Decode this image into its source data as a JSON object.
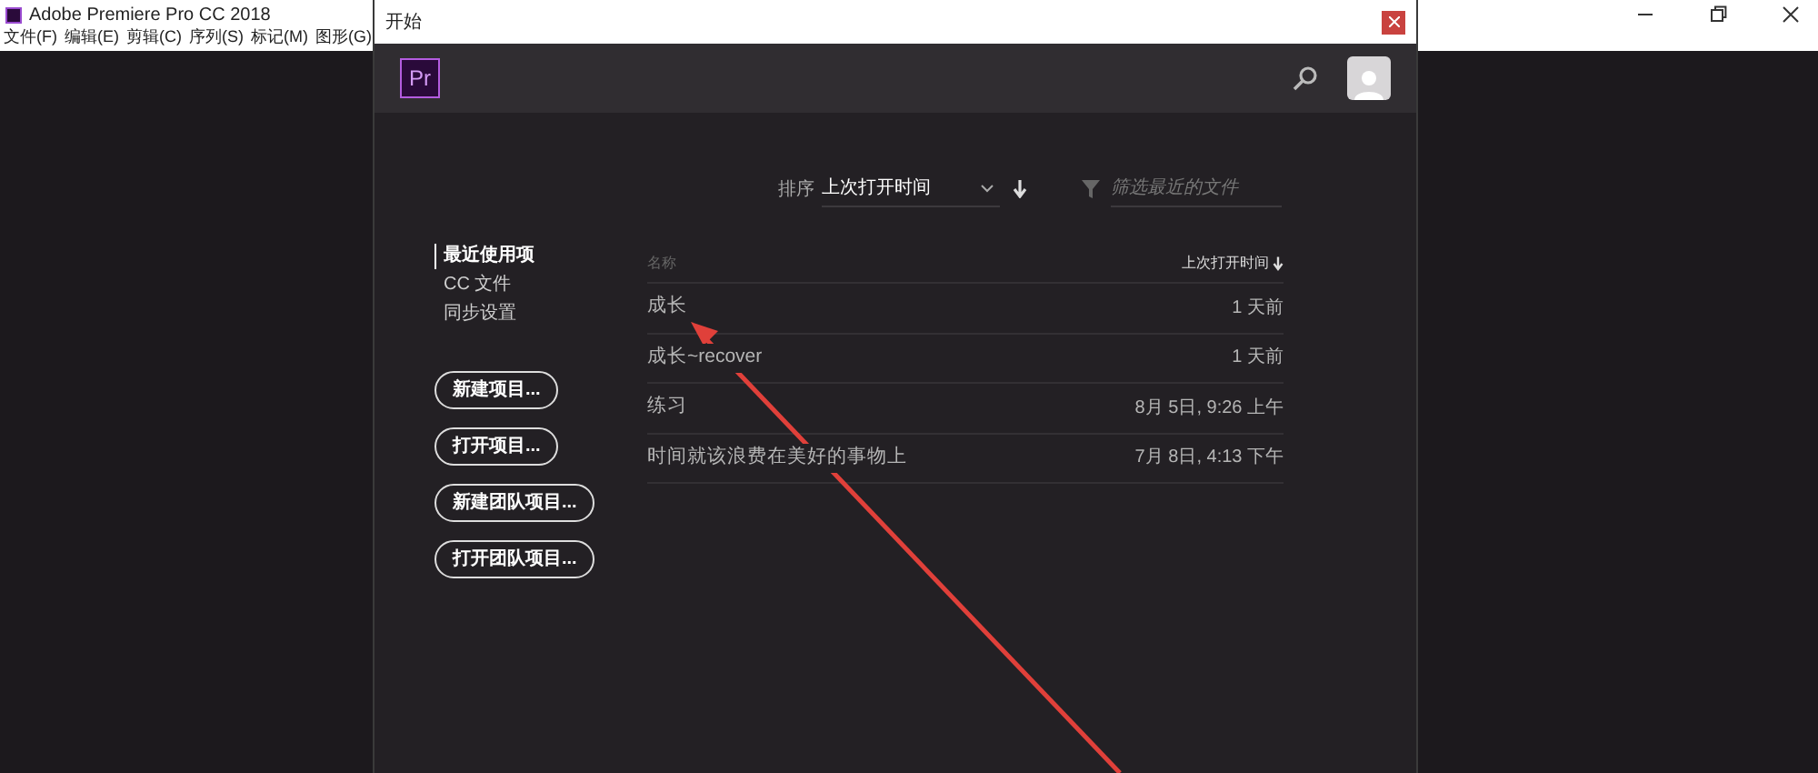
{
  "app": {
    "title": "Adobe Premiere Pro CC 2018",
    "menu": [
      "文件(F)",
      "编辑(E)",
      "剪辑(C)",
      "序列(S)",
      "标记(M)",
      "图形(G)"
    ]
  },
  "dialog": {
    "title": "开始",
    "logo": "Pr"
  },
  "sort": {
    "label": "排序",
    "value": "上次打开时间",
    "filter_placeholder": "筛选最近的文件"
  },
  "nav": [
    {
      "label": "最近使用项",
      "selected": true
    },
    {
      "label": "CC 文件",
      "selected": false
    },
    {
      "label": "同步设置",
      "selected": false
    }
  ],
  "buttons": [
    "新建项目...",
    "打开项目...",
    "新建团队项目...",
    "打开团队项目..."
  ],
  "table": {
    "columns": [
      "名称",
      "上次打开时间"
    ],
    "rows": [
      {
        "name": "成长",
        "time": "1 天前"
      },
      {
        "name": "成长~recover",
        "time": "1 天前"
      },
      {
        "name": "练习",
        "time": "8月 5日, 9:26 上午"
      },
      {
        "name": "时间就该浪费在美好的事物上",
        "time": "7月 8日, 4:13 下午"
      }
    ]
  }
}
